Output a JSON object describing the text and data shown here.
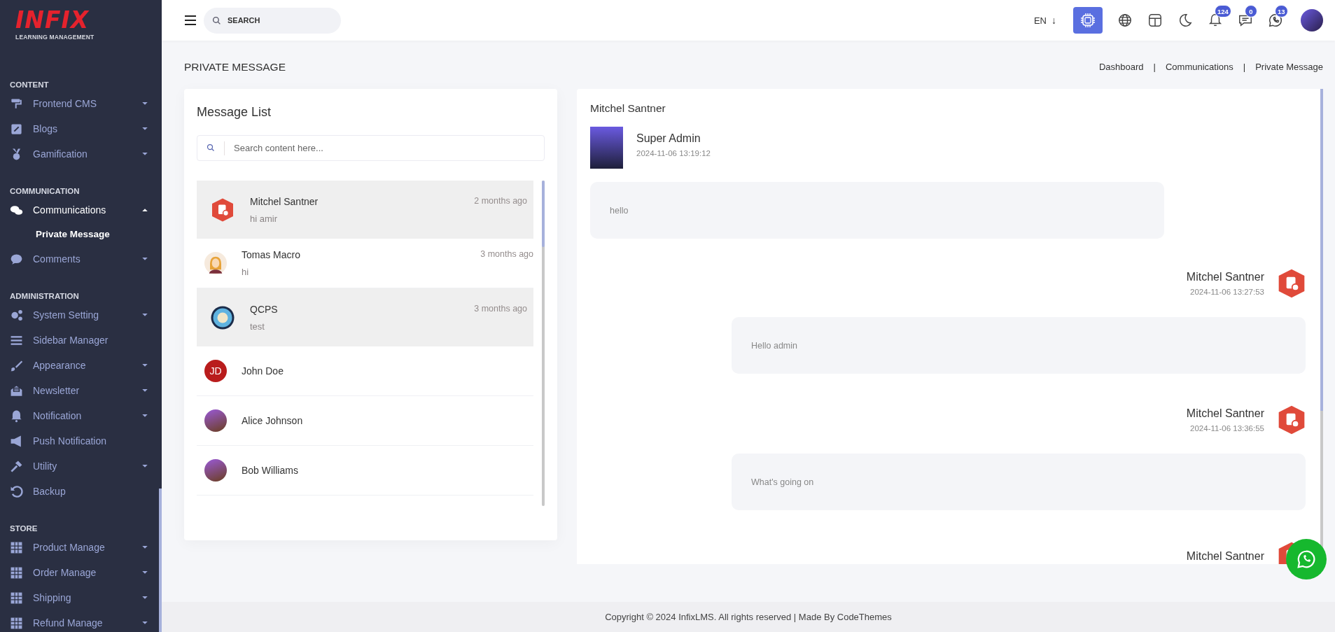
{
  "sidebar": {
    "logo": {
      "wordmark": "INFIX",
      "tagline": "LEARNING MANAGEMENT"
    },
    "sections": [
      {
        "heading": "CONTENT",
        "items": [
          {
            "label": "Frontend CMS",
            "kind": "group",
            "expanded": false,
            "selected": false
          },
          {
            "label": "Blogs",
            "kind": "group",
            "expanded": false,
            "selected": false
          },
          {
            "label": "Gamification",
            "kind": "group",
            "expanded": false,
            "selected": false
          }
        ]
      },
      {
        "heading": "COMMUNICATION",
        "items": [
          {
            "label": "Communications",
            "kind": "group",
            "expanded": true,
            "selected": true,
            "children": [
              {
                "label": "Private Message",
                "selected": true
              }
            ]
          },
          {
            "label": "Comments",
            "kind": "group",
            "expanded": false,
            "selected": false
          }
        ]
      },
      {
        "heading": "ADMINISTRATION",
        "items": [
          {
            "label": "System Setting",
            "kind": "group",
            "expanded": false,
            "selected": false
          },
          {
            "label": "Sidebar Manager",
            "kind": "link",
            "selected": false
          },
          {
            "label": "Appearance",
            "kind": "group",
            "expanded": false,
            "selected": false
          },
          {
            "label": "Newsletter",
            "kind": "group",
            "expanded": false,
            "selected": false
          },
          {
            "label": "Notification",
            "kind": "group",
            "expanded": false,
            "selected": false
          },
          {
            "label": "Push Notification",
            "kind": "link",
            "selected": false
          },
          {
            "label": "Utility",
            "kind": "group",
            "expanded": false,
            "selected": false
          },
          {
            "label": "Backup",
            "kind": "link",
            "selected": false
          }
        ]
      },
      {
        "heading": "STORE",
        "items": [
          {
            "label": "Product Manage",
            "kind": "group",
            "expanded": false,
            "selected": false
          },
          {
            "label": "Order Manage",
            "kind": "group",
            "expanded": false,
            "selected": false
          },
          {
            "label": "Shipping",
            "kind": "group",
            "expanded": false,
            "selected": false
          },
          {
            "label": "Refund Manage",
            "kind": "group",
            "expanded": false,
            "selected": false
          }
        ]
      }
    ]
  },
  "header": {
    "search": {
      "placeholder": "SEARCH"
    },
    "language": "EN",
    "language_arrow": "↓",
    "badges": [
      {
        "count": "124"
      },
      {
        "count": "0"
      },
      {
        "count": "13"
      }
    ]
  },
  "page": {
    "title": "PRIVATE MESSAGE",
    "breadcrumb": [
      "Dashboard",
      "Communications",
      "Private Message"
    ],
    "breadcrumb_separators": [
      "|",
      "|"
    ]
  },
  "message_list": {
    "title": "Message List",
    "search": {
      "placeholder": "Search content here..."
    },
    "conversations": [
      {
        "name": "Mitchel Santner",
        "time": "2 months ago",
        "preview": "hi amir",
        "avatar": {
          "kind": "hexagon"
        },
        "selected": true
      },
      {
        "name": "Tomas Macro",
        "time": "3 months ago",
        "preview": "hi",
        "avatar": {
          "kind": "cartoon"
        },
        "selected": false
      },
      {
        "name": "QCPS",
        "time": "3 months ago",
        "preview": "test",
        "avatar": {
          "kind": "seal"
        },
        "selected": true
      },
      {
        "name": "John Doe",
        "avatar": {
          "kind": "initials",
          "initials": "JD"
        },
        "selected": false
      },
      {
        "name": "Alice Johnson",
        "avatar": {
          "kind": "photo"
        },
        "selected": false
      },
      {
        "name": "Bob Williams",
        "avatar": {
          "kind": "photo"
        },
        "selected": false
      }
    ]
  },
  "chat": {
    "title": "Mitchel Santner",
    "messages": [
      {
        "kind": "received",
        "sender": "Super Admin",
        "time": "2024-11-06 13:19:12",
        "text": "hello",
        "avatar": {
          "kind": "photo"
        }
      },
      {
        "kind": "sent",
        "sender": "Mitchel Santner",
        "time": "2024-11-06 13:27:53",
        "text": "Hello admin",
        "avatar": {
          "kind": "hexagon"
        }
      },
      {
        "kind": "sent",
        "sender": "Mitchel Santner",
        "time": "2024-11-06 13:36:55",
        "text": "What's going on",
        "avatar": {
          "kind": "hexagon"
        }
      },
      {
        "kind": "sent",
        "sender": "Mitchel Santner",
        "avatar": {
          "kind": "hexagon"
        }
      }
    ]
  },
  "footer": {
    "text": "Copyright © 2024 InfixLMS. All rights reserved | Made By CodeThemes"
  }
}
